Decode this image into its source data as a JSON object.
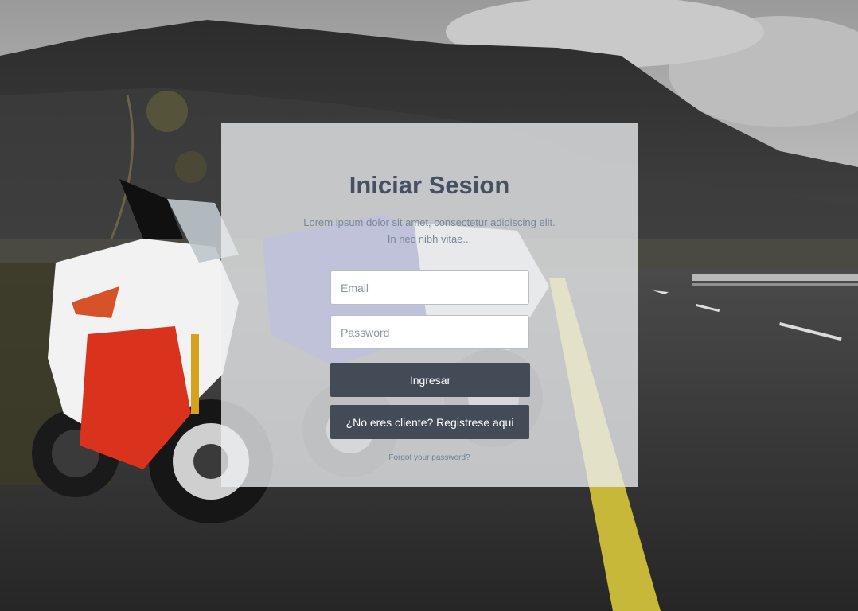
{
  "login": {
    "title": "Iniciar Sesion",
    "description_line1": "Lorem ipsum dolor sit amet, consectetur adipiscing elit.",
    "description_line2": "In nec nibh vitae...",
    "email_placeholder": "Email",
    "password_placeholder": "Password",
    "login_button_label": "Ingresar",
    "register_button_label": "¿No eres cliente? Registrese aqui",
    "forgot_password_label": "Forgot your password?"
  },
  "colors": {
    "button_bg": "#434b56",
    "title_text": "#465060",
    "panel_bg": "rgba(235,237,240,0.78)"
  }
}
